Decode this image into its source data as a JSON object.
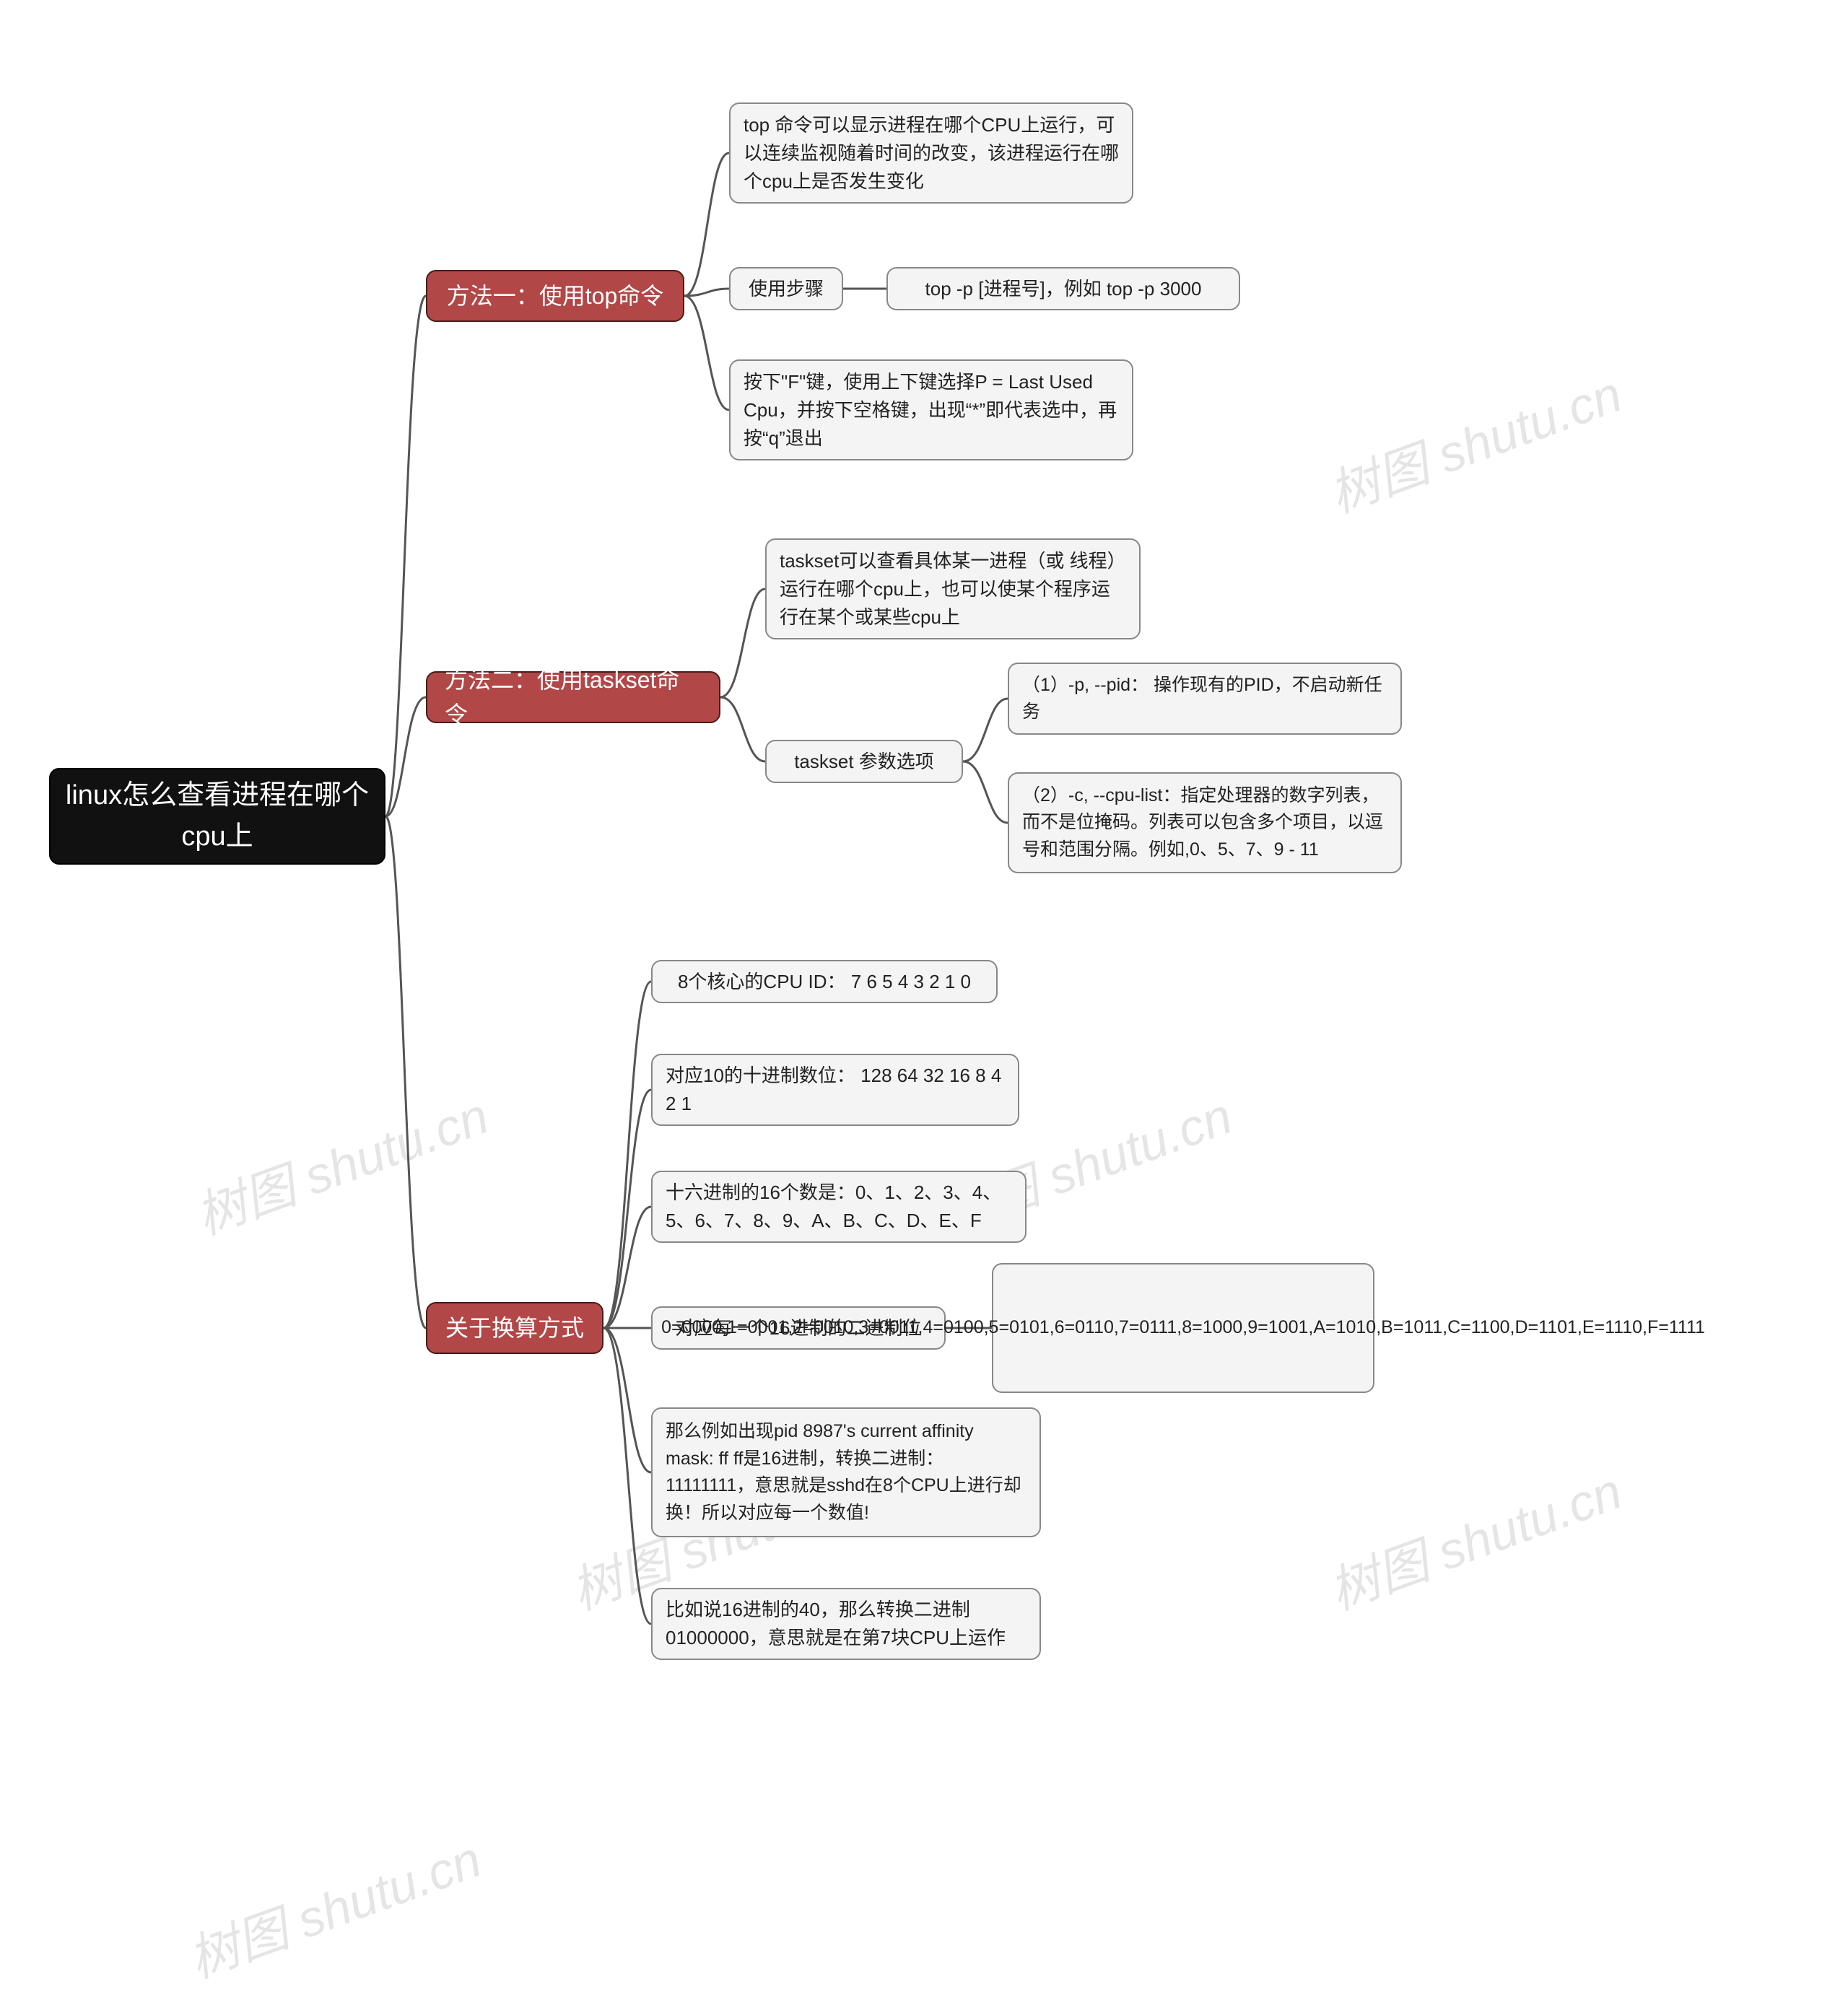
{
  "watermark": "树图 shutu.cn",
  "root": "linux怎么查看进程在哪个cpu上",
  "branch1": {
    "title": "方法一：使用top命令",
    "children": {
      "c1": "top 命令可以显示进程在哪个CPU上运行，可以连续监视随着时间的改变，该进程运行在哪个cpu上是否发生变化",
      "c2": "使用步骤",
      "c2a": "top -p [进程号]，例如 top -p 3000",
      "c3": "按下\"F\"键，使用上下键选择P = Last Used Cpu，并按下空格键，出现“*”即代表选中，再按“q”退出"
    }
  },
  "branch2": {
    "title": "方法二：使用taskset命令",
    "children": {
      "c1": "taskset可以查看具体某一进程（或 线程）运行在哪个cpu上，也可以使某个程序运行在某个或某些cpu上",
      "c2": "taskset 参数选项",
      "c2a": "（1）-p, --pid： 操作现有的PID，不启动新任务",
      "c2b": "（2）-c, --cpu-list：指定处理器的数字列表，而不是位掩码。列表可以包含多个项目，以逗号和范围分隔。例如,0、5、7、9 - 11"
    }
  },
  "branch3": {
    "title": "关于换算方式",
    "children": {
      "c1": "8个核心的CPU ID： 7 6 5 4 3 2 1 0",
      "c2": "对应10的十进制数位：  128 64 32 16 8 4 2 1",
      "c3": "十六进制的16个数是：0、1、2、3、4、5、6、7、8、9、A、B、C、D、E、F",
      "c4": "对应每一个16进制的二进制位",
      "c4a": "0=0000,1=0001,2=0010,3=0011,4=0100,5=0101,6=0110,7=0111,8=1000,9=1001,A=1010,B=1011,C=1100,D=1101,E=1110,F=1111",
      "c5": "那么例如出现pid 8987's current affinity mask: ff ff是16进制，转换二进制：11111111，意思就是sshd在8个CPU上进行却换！所以对应每一个数值!",
      "c6": "比如说16进制的40，那么转换二进制01000000，意思就是在第7块CPU上运作"
    }
  }
}
